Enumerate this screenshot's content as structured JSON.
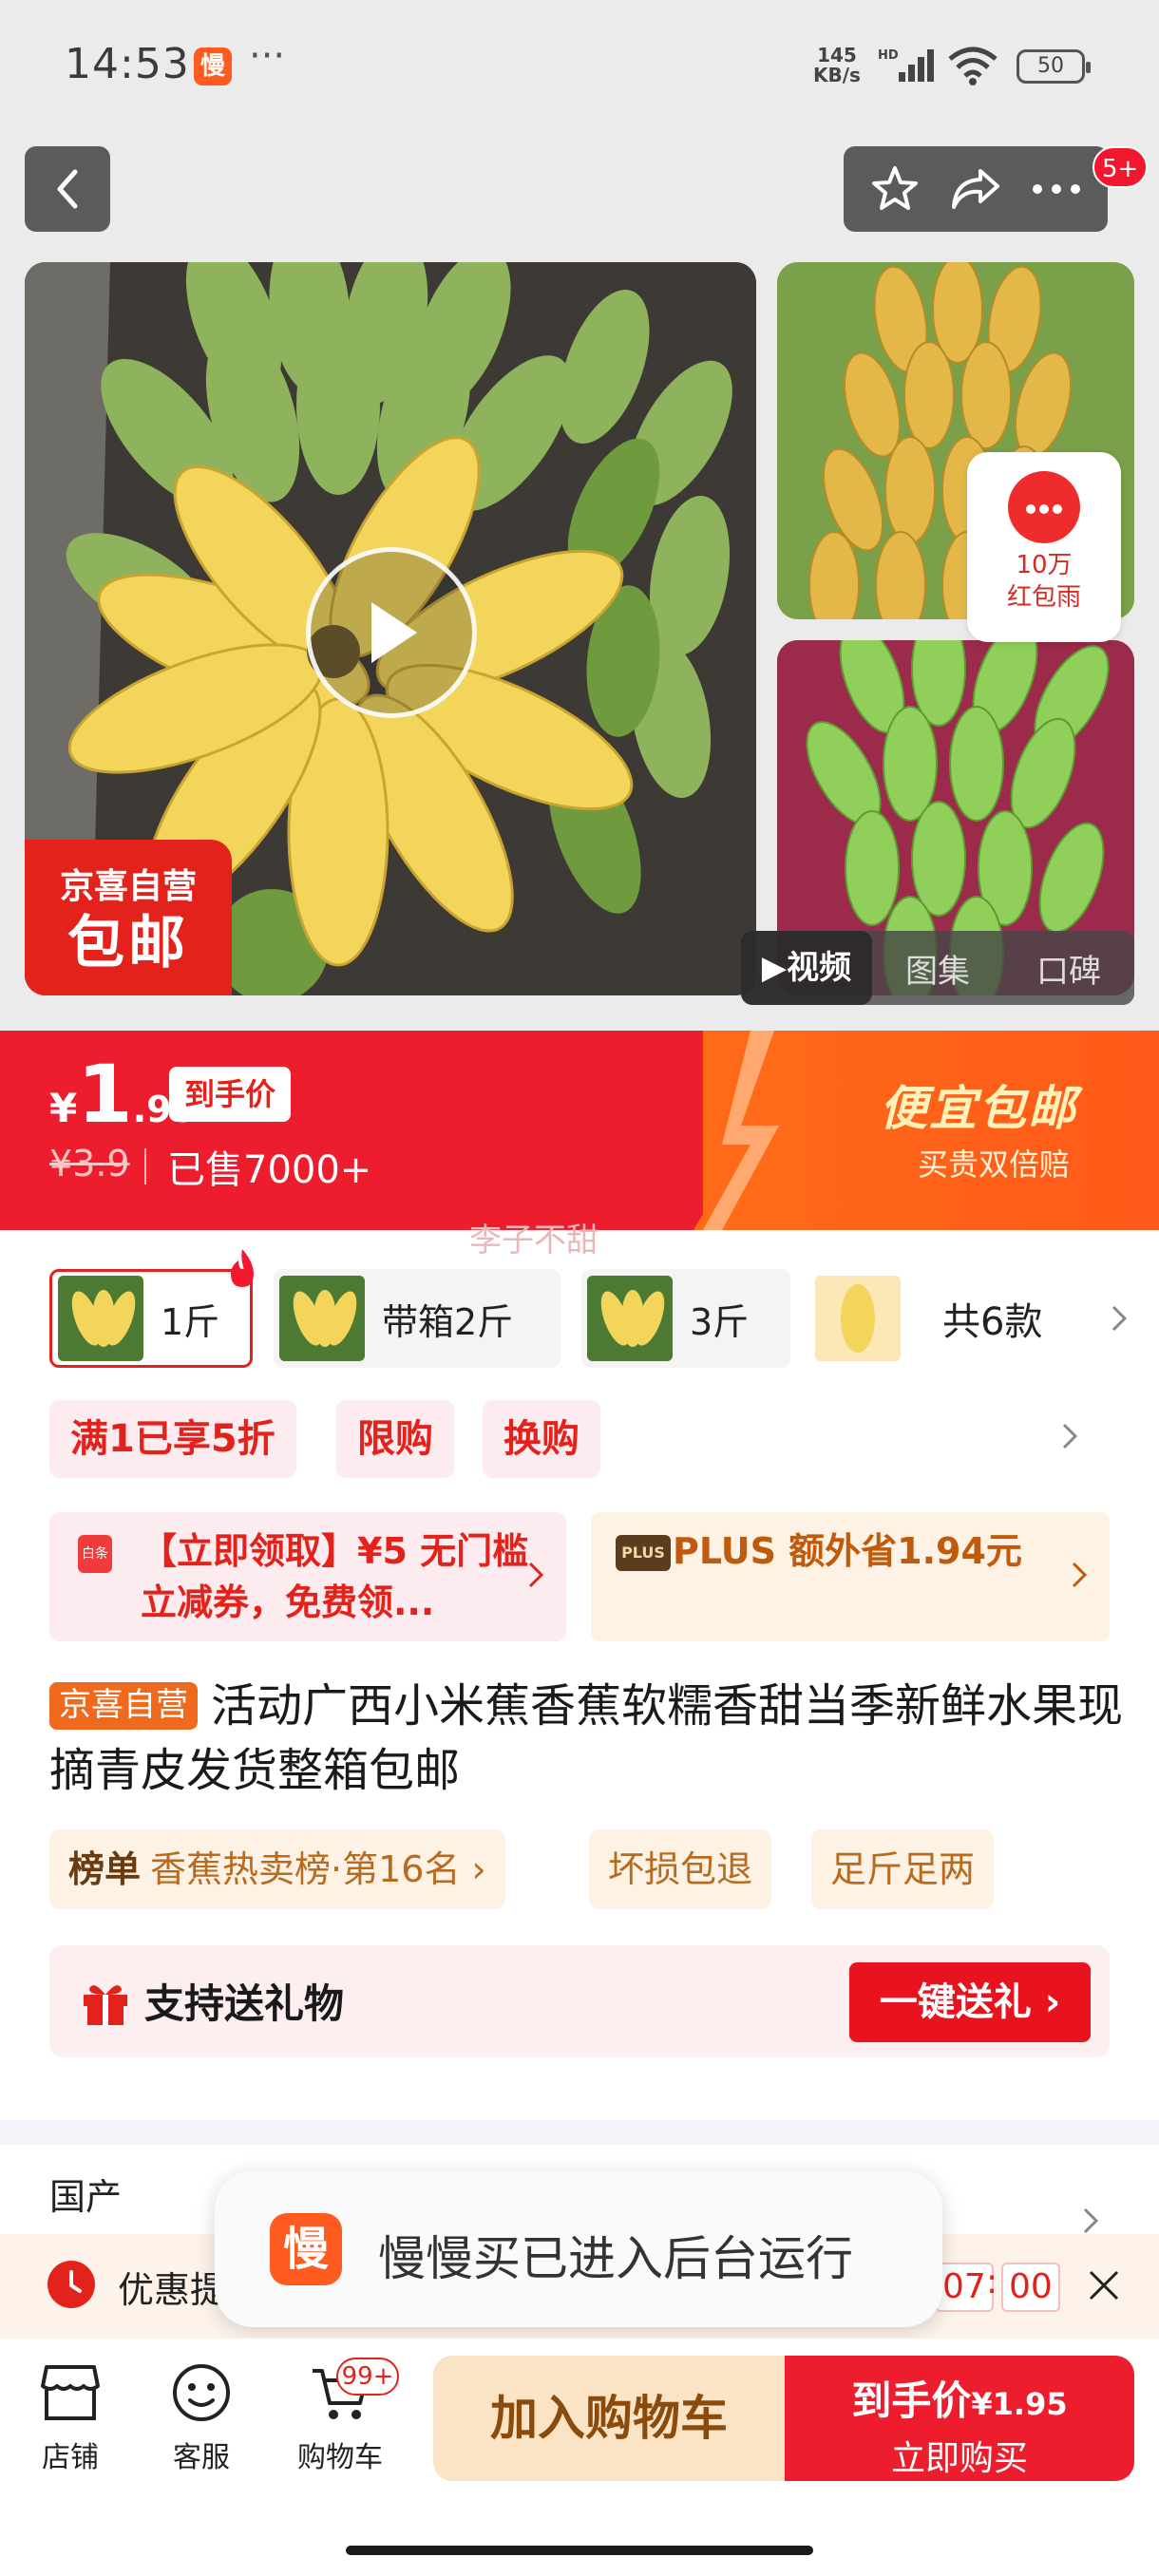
{
  "status_bar": {
    "time": "14:53",
    "app_icon_char": "慢",
    "more": "···",
    "net_speed_value": "145",
    "net_speed_unit": "KB/s",
    "battery": "50"
  },
  "gallery": {
    "ship_badge_line1": "京喜自营",
    "ship_badge_line2": "包邮",
    "message_badge": "5+",
    "redpacket_line1": "10万",
    "redpacket_line2": "红包雨",
    "media_tabs": [
      "视频",
      "图集",
      "口碑"
    ]
  },
  "price": {
    "currency": "¥",
    "integer": "1",
    "decimal": ".95",
    "tag": "到手价",
    "old_price": "¥3.9",
    "sold": "已售7000+",
    "promo_title": "便宜包邮",
    "promo_sub": "买贵双倍赔",
    "watermark": "李子不甜"
  },
  "skus": [
    {
      "label": "1斤"
    },
    {
      "label": "带箱2斤"
    },
    {
      "label": "3斤"
    }
  ],
  "sku_more": "共6款",
  "promo_tags": [
    "满1已享5折",
    "限购",
    "换购"
  ],
  "coupons": {
    "coupon1_icon": "白条",
    "coupon1_text": "【立即领取】¥5 无门槛立减券，免费领...",
    "coupon2_icon": "PLUS",
    "coupon2_text": "PLUS 额外省1.94元"
  },
  "product": {
    "badge": "京喜自营",
    "title": "活动广西小米蕉香蕉软糯香甜当季新鲜水果现摘青皮发货整箱包邮"
  },
  "rank": {
    "label": "榜单",
    "text": "香蕉热卖榜·第16名",
    "tag1": "坏损包退",
    "tag2": "足斤足两"
  },
  "gift": {
    "text": "支持送礼物",
    "button": "一键送礼"
  },
  "origin": "国产",
  "countdown": {
    "text": "优惠提",
    "minutes": "07",
    "seconds": "00"
  },
  "toast": {
    "icon_char": "慢",
    "text": "慢慢买已进入后台运行"
  },
  "bottom_nav": {
    "shop": "店铺",
    "service": "客服",
    "cart": "购物车",
    "cart_badge": "99+",
    "add_cart": "加入购物车",
    "buy_price_label": "到手价",
    "buy_price": "¥1.95",
    "buy_now": "立即购买"
  },
  "colors": {
    "brand_red": "#ee1d2e",
    "orange": "#ff6a18"
  }
}
